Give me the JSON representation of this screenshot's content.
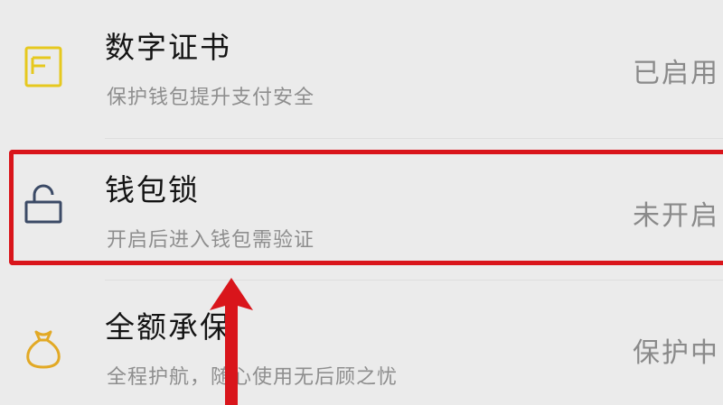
{
  "rows": [
    {
      "title": "数字证书",
      "subtitle": "保护钱包提升支付安全",
      "status": "已启用",
      "icon": "certificate-icon",
      "icon_color": "#e6c81e"
    },
    {
      "title": "钱包锁",
      "subtitle": "开启后进入钱包需验证",
      "status": "未开启",
      "icon": "lock-icon",
      "icon_color": "#3b4a66"
    },
    {
      "title": "全额承保",
      "subtitle": "全程护航，随心使用无后顾之忧",
      "status": "保护中",
      "icon": "money-bag-icon",
      "icon_color": "#e2a925"
    }
  ],
  "annotation": {
    "highlight_color": "#d9151b",
    "arrow_color": "#d9151b"
  }
}
